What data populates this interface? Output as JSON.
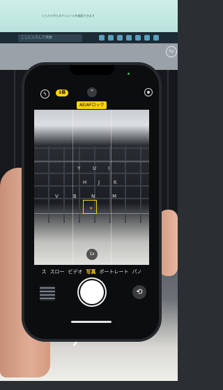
{
  "background": {
    "laptop_search_text": "ここに入力して検索",
    "laptop_screen_text": "ジョルテからスケジュールを検索できます",
    "brand_logo_text": "hp"
  },
  "camera": {
    "live_badge": "1倍",
    "ae_af_lock": "AE/AFロック",
    "zoom_label": "1x",
    "modes": [
      "ス",
      "スロー",
      "ビデオ",
      "写真",
      "ポートレート",
      "パノ"
    ],
    "active_mode": "写真",
    "keyboard_keys": [
      "Y",
      "U",
      "I",
      "H",
      "J",
      "K",
      "V",
      "B",
      "N",
      "M"
    ]
  },
  "colors": {
    "accent": "#ffd60a",
    "phone_body": "#0b0d0f"
  }
}
